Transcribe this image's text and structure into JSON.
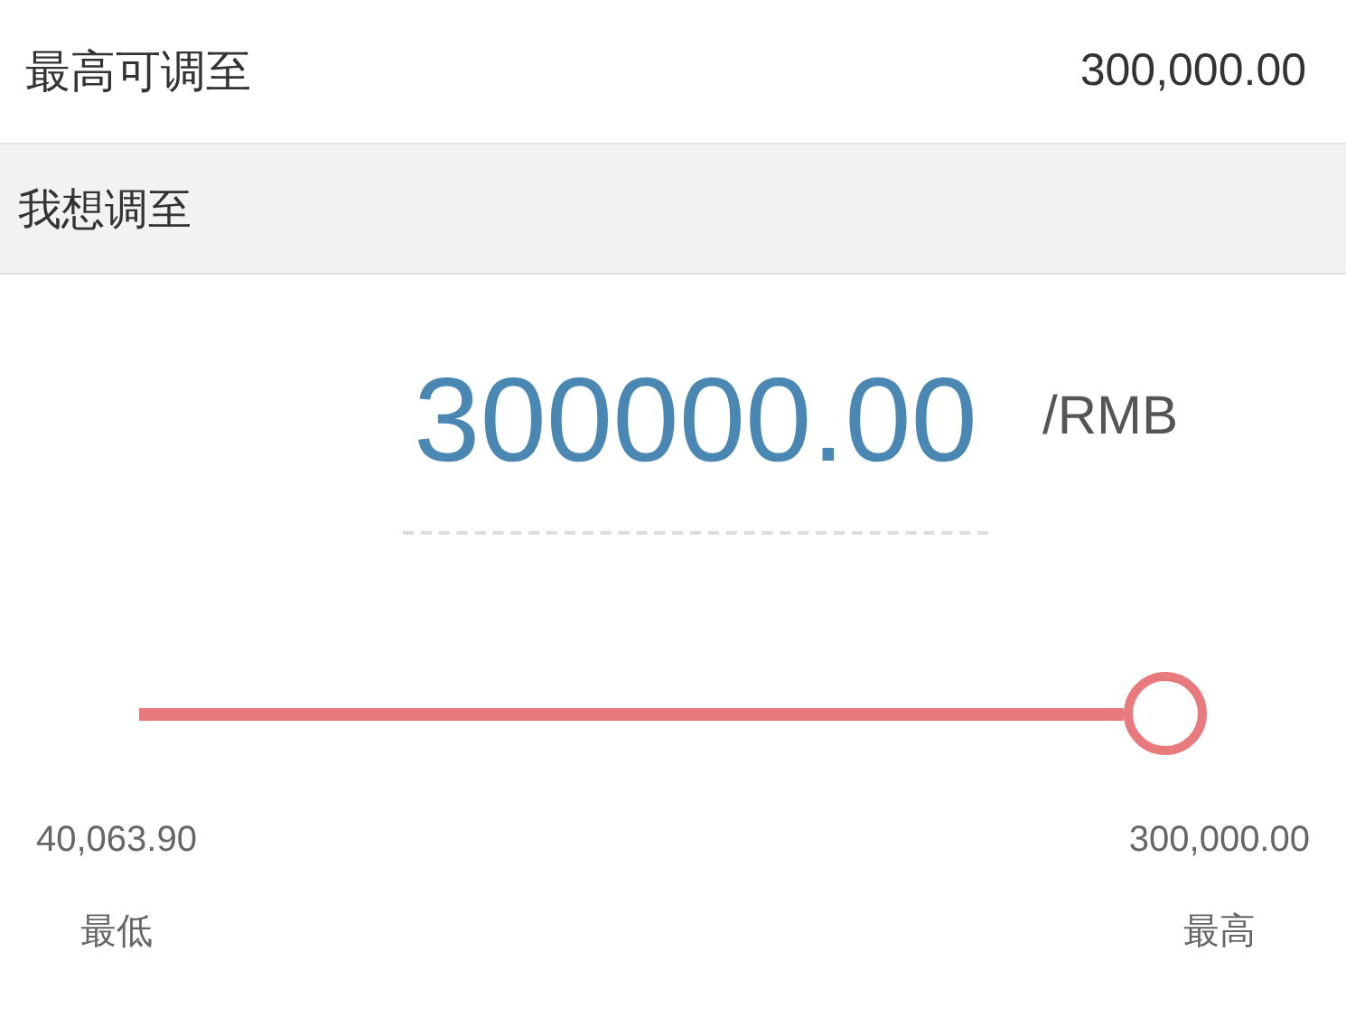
{
  "max_adjustable": {
    "label": "最高可调至",
    "value": "300,000.00"
  },
  "section_header": "我想调至",
  "amount": {
    "value": "300000.00",
    "unit": "/RMB"
  },
  "slider": {
    "level": 1
  },
  "range": [
    {
      "value": "40,063.90",
      "label": "最低"
    },
    {
      "value": "300,000.00",
      "label": "最高"
    }
  ]
}
